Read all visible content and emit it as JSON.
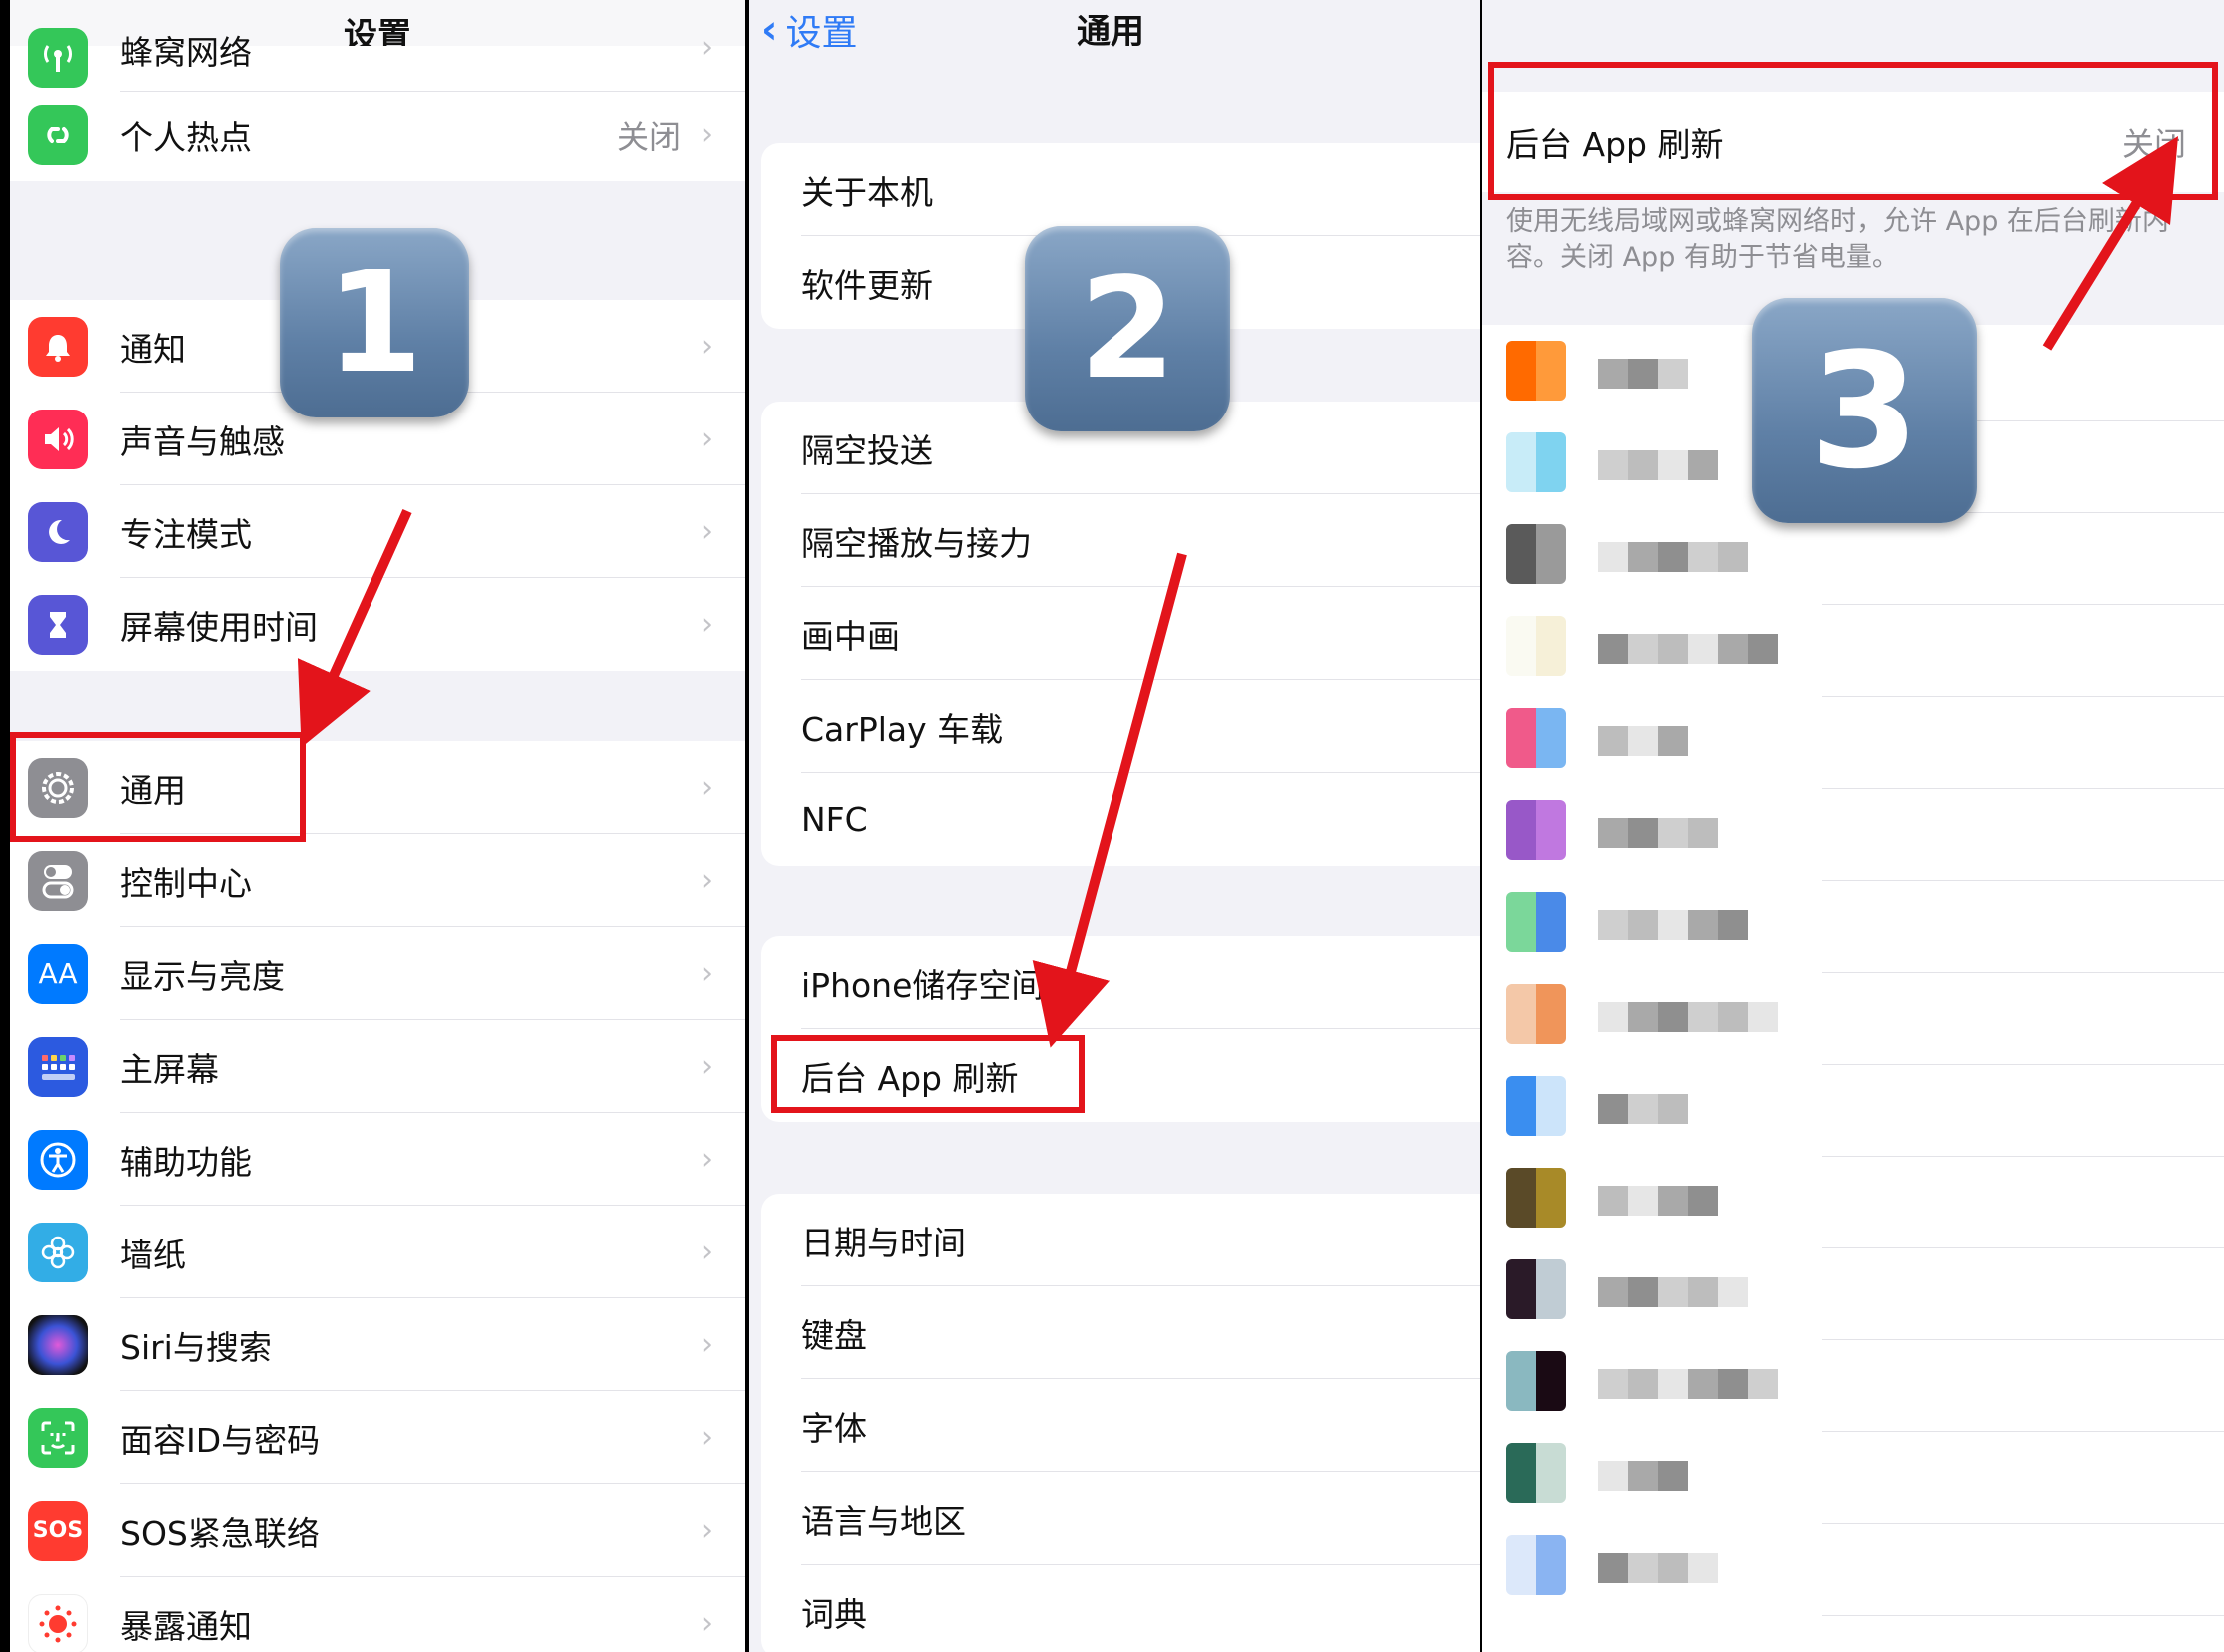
{
  "panel1": {
    "title": "设置",
    "rows": [
      {
        "label": "蜂窝网络",
        "icon": "cellular-icon",
        "color": "#34c759"
      },
      {
        "label": "个人热点",
        "value": "关闭",
        "icon": "hotspot-icon",
        "color": "#34c759"
      },
      {
        "label": "通知",
        "icon": "bell-icon",
        "color": "#ff3b30"
      },
      {
        "label": "声音与触感",
        "icon": "speaker-icon",
        "color": "#ff2d55"
      },
      {
        "label": "专注模式",
        "icon": "moon-icon",
        "color": "#5856d6"
      },
      {
        "label": "屏幕使用时间",
        "icon": "hourglass-icon",
        "color": "#5856d6"
      },
      {
        "label": "通用",
        "icon": "gear-icon",
        "color": "#8e8e93"
      },
      {
        "label": "控制中心",
        "icon": "toggles-icon",
        "color": "#8e8e93"
      },
      {
        "label": "显示与亮度",
        "icon": "text-size-icon",
        "icon_text": "AA",
        "color": "#007aff"
      },
      {
        "label": "主屏幕",
        "icon": "grid-icon",
        "color": "#2c5ae0"
      },
      {
        "label": "辅助功能",
        "icon": "accessibility-icon",
        "color": "#007aff"
      },
      {
        "label": "墙纸",
        "icon": "flower-icon",
        "color": "#32ade6"
      },
      {
        "label": "Siri与搜索",
        "icon": "siri-icon",
        "color": "#222"
      },
      {
        "label": "面容ID与密码",
        "icon": "faceid-icon",
        "color": "#34c759"
      },
      {
        "label": "SOS紧急联络",
        "icon": "sos-icon",
        "icon_text": "SOS",
        "color": "#ff3b30"
      },
      {
        "label": "暴露通知",
        "icon": "exposure-icon",
        "color": "#fff"
      }
    ],
    "badge": "1"
  },
  "panel2": {
    "back_label": "设置",
    "title": "通用",
    "groups": [
      [
        "关于本机",
        "软件更新"
      ],
      [
        "隔空投送",
        "隔空播放与接力",
        "画中画",
        "CarPlay 车载",
        "NFC"
      ],
      [
        "iPhone储存空间",
        "后台 App 刷新"
      ],
      [
        "日期与时间",
        "键盘",
        "字体",
        "语言与地区",
        "词典"
      ]
    ],
    "badge": "2"
  },
  "panel3": {
    "row_label": "后台 App 刷新",
    "row_value": "关闭",
    "footer": "使用无线局域网或蜂窝网络时，允许 App 在后台刷新内容。关闭 App 有助于节省电量。",
    "badge": "3"
  },
  "colors": {
    "highlight": "#e3141b",
    "link": "#2f7bf6"
  }
}
